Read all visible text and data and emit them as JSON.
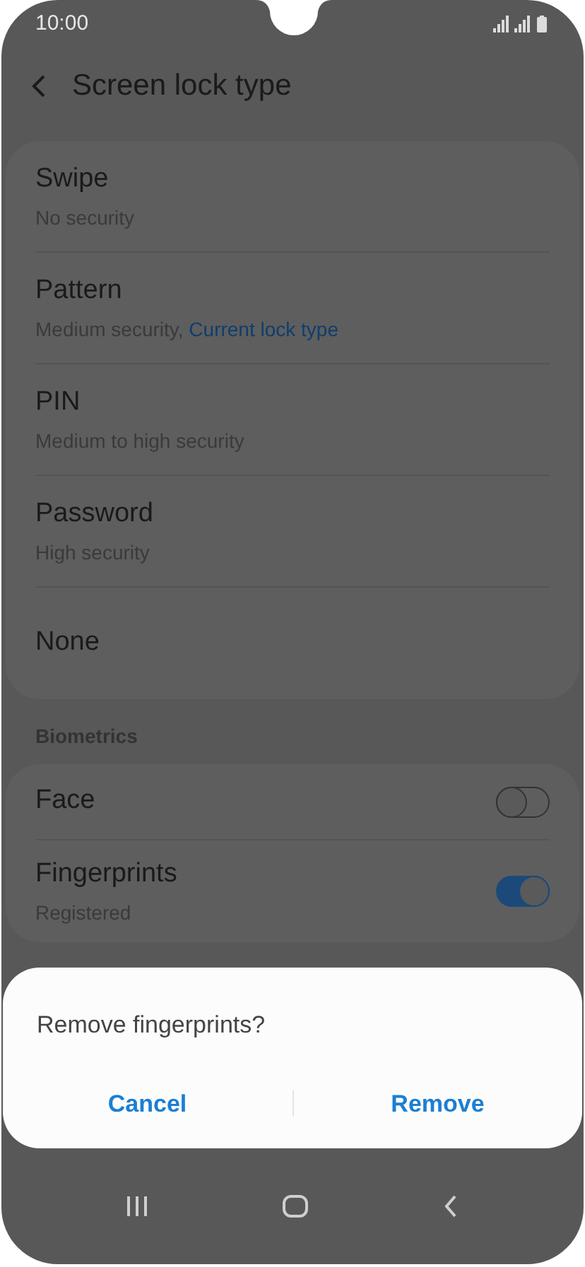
{
  "status_bar": {
    "time": "10:00"
  },
  "header": {
    "title": "Screen lock type"
  },
  "lock_types": [
    {
      "title": "Swipe",
      "subtitle": "No security"
    },
    {
      "title": "Pattern",
      "subtitle": "Medium security,",
      "note": "Current lock type"
    },
    {
      "title": "PIN",
      "subtitle": "Medium to high security"
    },
    {
      "title": "Password",
      "subtitle": "High security"
    },
    {
      "title": "None"
    }
  ],
  "biometrics": {
    "heading": "Biometrics",
    "items": [
      {
        "title": "Face",
        "on": false
      },
      {
        "title": "Fingerprints",
        "subtitle": "Registered",
        "on": true
      }
    ]
  },
  "dialog": {
    "message": "Remove fingerprints?",
    "buttons": [
      "Cancel",
      "Remove"
    ]
  }
}
